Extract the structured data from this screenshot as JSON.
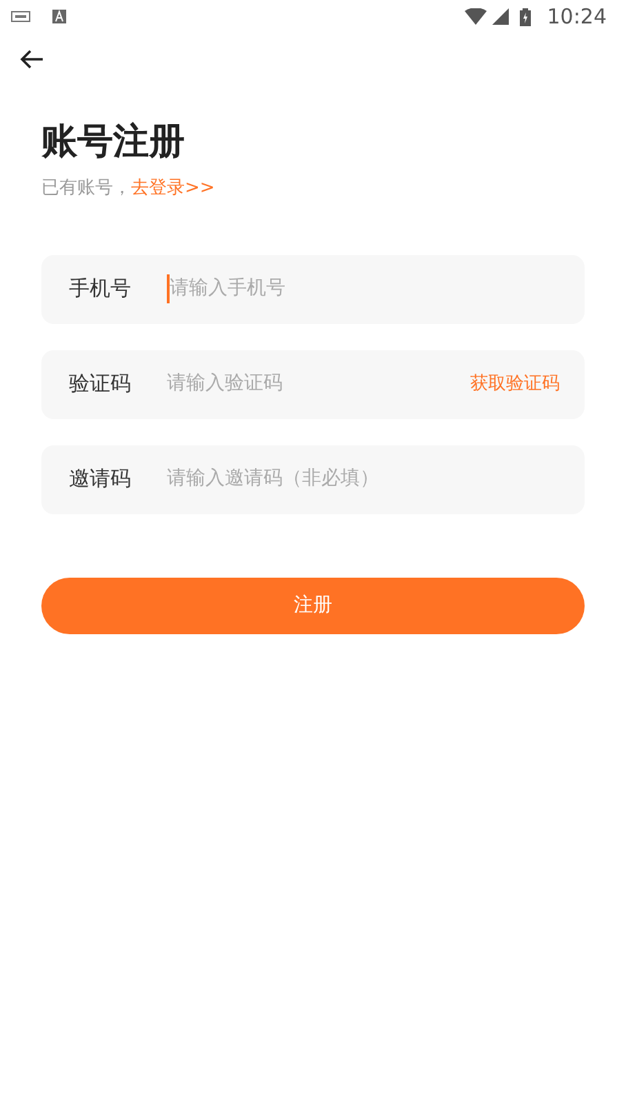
{
  "status_bar": {
    "time": "10:24"
  },
  "title": "账号注册",
  "subtitle": {
    "text": "已有账号，",
    "link": "去登录>>"
  },
  "fields": [
    {
      "label": "手机号",
      "placeholder": "请输入手机号",
      "focused": true
    },
    {
      "label": "验证码",
      "placeholder": "请输入验证码",
      "focused": false,
      "action": "获取验证码"
    },
    {
      "label": "邀请码",
      "placeholder": "请输入邀请码（非必填）",
      "focused": false
    }
  ],
  "submit": "注册"
}
